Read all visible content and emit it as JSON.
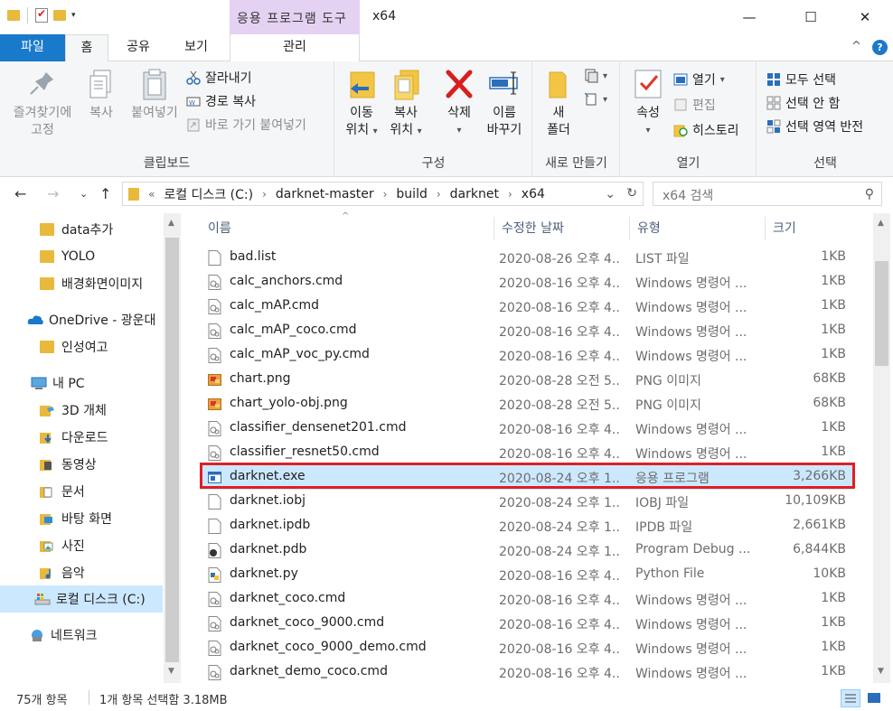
{
  "window": {
    "title": "x64",
    "context_tab_header": "응용 프로그램 도구",
    "controls": {
      "minimize": "—",
      "maximize": "☐",
      "close": "✕"
    }
  },
  "ribbon": {
    "tabs": {
      "file": "파일",
      "home": "홈",
      "share": "공유",
      "view": "보기",
      "manage": "관리"
    },
    "collapse": "^",
    "help": "?",
    "clipboard": {
      "label": "클립보드",
      "pin": [
        "즐겨찾기에",
        "고정"
      ],
      "copy": "복사",
      "paste": "붙여넣기",
      "cut": "잘라내기",
      "copy_path": "경로 복사",
      "paste_shortcut": "바로 가기 붙여넣기"
    },
    "organize": {
      "label": "구성",
      "move_to": [
        "이동",
        "위치"
      ],
      "copy_to": [
        "복사",
        "위치"
      ],
      "delete": "삭제",
      "rename": [
        "이름",
        "바꾸기"
      ]
    },
    "new": {
      "label": "새로 만들기",
      "new_folder": [
        "새",
        "폴더"
      ]
    },
    "open": {
      "label": "열기",
      "properties": "속성",
      "open": "열기",
      "edit": "편집",
      "history": "히스토리"
    },
    "select": {
      "label": "선택",
      "select_all": "모두 선택",
      "select_none": "선택 안 함",
      "invert": "선택 영역 반전"
    }
  },
  "address": {
    "prefix": "«",
    "segments": [
      "로컬 디스크 (C:)",
      "darknet-master",
      "build",
      "darknet",
      "x64"
    ],
    "search_placeholder": "x64 검색"
  },
  "nav": {
    "items": [
      {
        "label": "data추가",
        "icon": "folder-icon"
      },
      {
        "label": "YOLO",
        "icon": "folder-icon"
      },
      {
        "label": "배경화면이미지",
        "icon": "folder-icon"
      },
      {
        "label": "OneDrive - 광운대",
        "icon": "onedrive-icon"
      },
      {
        "label": "인성여고",
        "icon": "folder-icon"
      },
      {
        "label": "내 PC",
        "icon": "pc-icon"
      },
      {
        "label": "3D 개체",
        "icon": "3d-objects-icon"
      },
      {
        "label": "다운로드",
        "icon": "downloads-icon"
      },
      {
        "label": "동영상",
        "icon": "videos-icon"
      },
      {
        "label": "문서",
        "icon": "documents-icon"
      },
      {
        "label": "바탕 화면",
        "icon": "desktop-icon"
      },
      {
        "label": "사진",
        "icon": "pictures-icon"
      },
      {
        "label": "음악",
        "icon": "music-icon"
      },
      {
        "label": "로컬 디스크 (C:)",
        "icon": "drive-icon"
      },
      {
        "label": "네트워크",
        "icon": "network-icon"
      }
    ]
  },
  "columns": {
    "name": "이름",
    "date": "수정한 날짜",
    "type": "유형",
    "size": "크기"
  },
  "files": [
    {
      "name": "bad.list",
      "date": "2020-08-26 오후 4...",
      "type": "LIST 파일",
      "size": "1KB",
      "icon": "file-icon"
    },
    {
      "name": "calc_anchors.cmd",
      "date": "2020-08-16 오후 4...",
      "type": "Windows 명령어 ...",
      "size": "1KB",
      "icon": "cmd-icon"
    },
    {
      "name": "calc_mAP.cmd",
      "date": "2020-08-16 오후 4...",
      "type": "Windows 명령어 ...",
      "size": "1KB",
      "icon": "cmd-icon"
    },
    {
      "name": "calc_mAP_coco.cmd",
      "date": "2020-08-16 오후 4...",
      "type": "Windows 명령어 ...",
      "size": "1KB",
      "icon": "cmd-icon"
    },
    {
      "name": "calc_mAP_voc_py.cmd",
      "date": "2020-08-16 오후 4...",
      "type": "Windows 명령어 ...",
      "size": "1KB",
      "icon": "cmd-icon"
    },
    {
      "name": "chart.png",
      "date": "2020-08-28 오전 5...",
      "type": "PNG 이미지",
      "size": "68KB",
      "icon": "image-icon"
    },
    {
      "name": "chart_yolo-obj.png",
      "date": "2020-08-28 오전 5...",
      "type": "PNG 이미지",
      "size": "68KB",
      "icon": "image-icon"
    },
    {
      "name": "classifier_densenet201.cmd",
      "date": "2020-08-16 오후 4...",
      "type": "Windows 명령어 ...",
      "size": "1KB",
      "icon": "cmd-icon"
    },
    {
      "name": "classifier_resnet50.cmd",
      "date": "2020-08-16 오후 4...",
      "type": "Windows 명령어 ...",
      "size": "1KB",
      "icon": "cmd-icon"
    },
    {
      "name": "darknet.exe",
      "date": "2020-08-24 오후 1...",
      "type": "응용 프로그램",
      "size": "3,266KB",
      "icon": "exe-icon",
      "selected": true
    },
    {
      "name": "darknet.iobj",
      "date": "2020-08-24 오후 1...",
      "type": "IOBJ 파일",
      "size": "10,109KB",
      "icon": "file-icon"
    },
    {
      "name": "darknet.ipdb",
      "date": "2020-08-24 오후 1...",
      "type": "IPDB 파일",
      "size": "2,661KB",
      "icon": "file-icon"
    },
    {
      "name": "darknet.pdb",
      "date": "2020-08-24 오후 1...",
      "type": "Program Debug ...",
      "size": "6,844KB",
      "icon": "pdb-icon"
    },
    {
      "name": "darknet.py",
      "date": "2020-08-16 오후 4...",
      "type": "Python File",
      "size": "10KB",
      "icon": "python-icon"
    },
    {
      "name": "darknet_coco.cmd",
      "date": "2020-08-16 오후 4...",
      "type": "Windows 명령어 ...",
      "size": "1KB",
      "icon": "cmd-icon"
    },
    {
      "name": "darknet_coco_9000.cmd",
      "date": "2020-08-16 오후 4...",
      "type": "Windows 명령어 ...",
      "size": "1KB",
      "icon": "cmd-icon"
    },
    {
      "name": "darknet_coco_9000_demo.cmd",
      "date": "2020-08-16 오후 4...",
      "type": "Windows 명령어 ...",
      "size": "1KB",
      "icon": "cmd-icon"
    },
    {
      "name": "darknet_demo_coco.cmd",
      "date": "2020-08-16 오후 4...",
      "type": "Windows 명령어 ...",
      "size": "1KB",
      "icon": "cmd-icon"
    }
  ],
  "status": {
    "item_count": "75개 항목",
    "selection": "1개 항목 선택함 3.18MB"
  },
  "colors": {
    "accent": "#1979ca",
    "selection": "#cce8ff",
    "highlight_box": "#e01e25",
    "context_tab": "#e5d2f2"
  }
}
